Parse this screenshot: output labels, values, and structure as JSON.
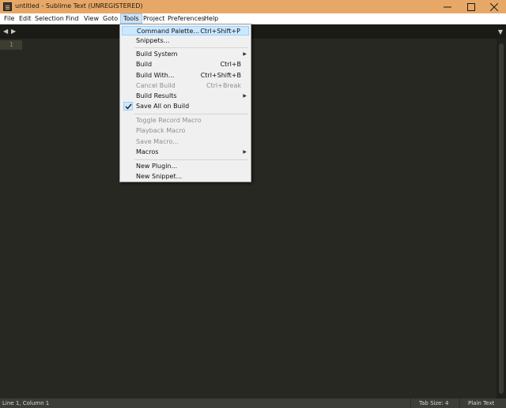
{
  "window": {
    "title": "untitled - Sublime Text (UNREGISTERED)",
    "controls": [
      "minimize-icon",
      "maximize-icon",
      "close-icon"
    ]
  },
  "menubar": {
    "items": [
      "File",
      "Edit",
      "Selection",
      "Find",
      "View",
      "Goto",
      "Tools",
      "Project",
      "Preferences",
      "Help"
    ],
    "active": "Tools"
  },
  "tabbar": {
    "icons": [
      "chevron-left-icon",
      "chevron-right-icon",
      "chevron-down-icon"
    ]
  },
  "editor": {
    "line_number": "1"
  },
  "statusbar": {
    "position": "Line 1, Column 1",
    "tab_size": "Tab Size: 4",
    "syntax": "Plain Text"
  },
  "tools_menu": {
    "items": [
      {
        "label": "Command Palette...",
        "shortcut": "Ctrl+Shift+P"
      },
      {
        "label": "Snippets..."
      },
      {
        "label": "Build System"
      },
      {
        "label": "Build",
        "shortcut": "Ctrl+B"
      },
      {
        "label": "Build With...",
        "shortcut": "Ctrl+Shift+B"
      },
      {
        "label": "Cancel Build",
        "shortcut": "Ctrl+Break"
      },
      {
        "label": "Build Results"
      },
      {
        "label": "Save All on Build"
      },
      {
        "label": "Toggle Record Macro"
      },
      {
        "label": "Playback Macro"
      },
      {
        "label": "Save Macro..."
      },
      {
        "label": "Macros"
      },
      {
        "label": "New Plugin..."
      },
      {
        "label": "New Snippet..."
      }
    ]
  },
  "colors": {
    "titlebar": "#e7a867",
    "editor_bg": "#272822",
    "menu_highlight": "#cce8ff"
  }
}
